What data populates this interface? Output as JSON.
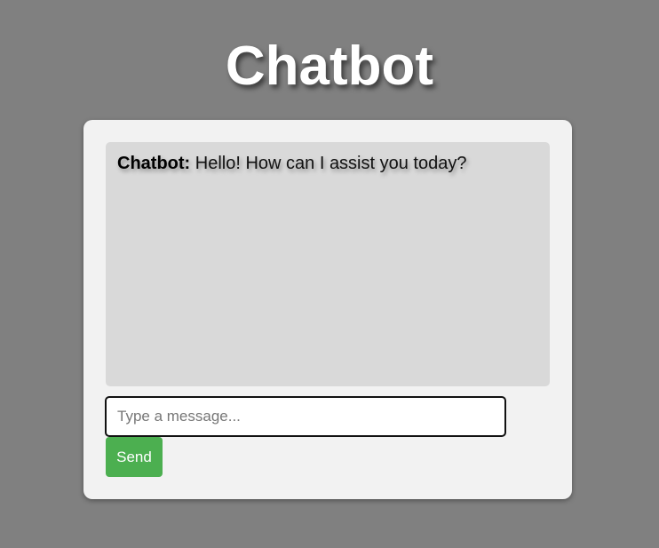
{
  "header": {
    "title": "Chatbot"
  },
  "chat": {
    "messages": [
      {
        "sender": "Chatbot:",
        "text": "Hello! How can I assist you today?"
      }
    ]
  },
  "composer": {
    "input_value": "",
    "input_placeholder": "Type a message...",
    "send_label": "Send"
  },
  "colors": {
    "page_background": "#808080",
    "panel_background": "#f2f2f2",
    "chat_log_background": "#d9d9d9",
    "send_button": "#4caf50"
  }
}
